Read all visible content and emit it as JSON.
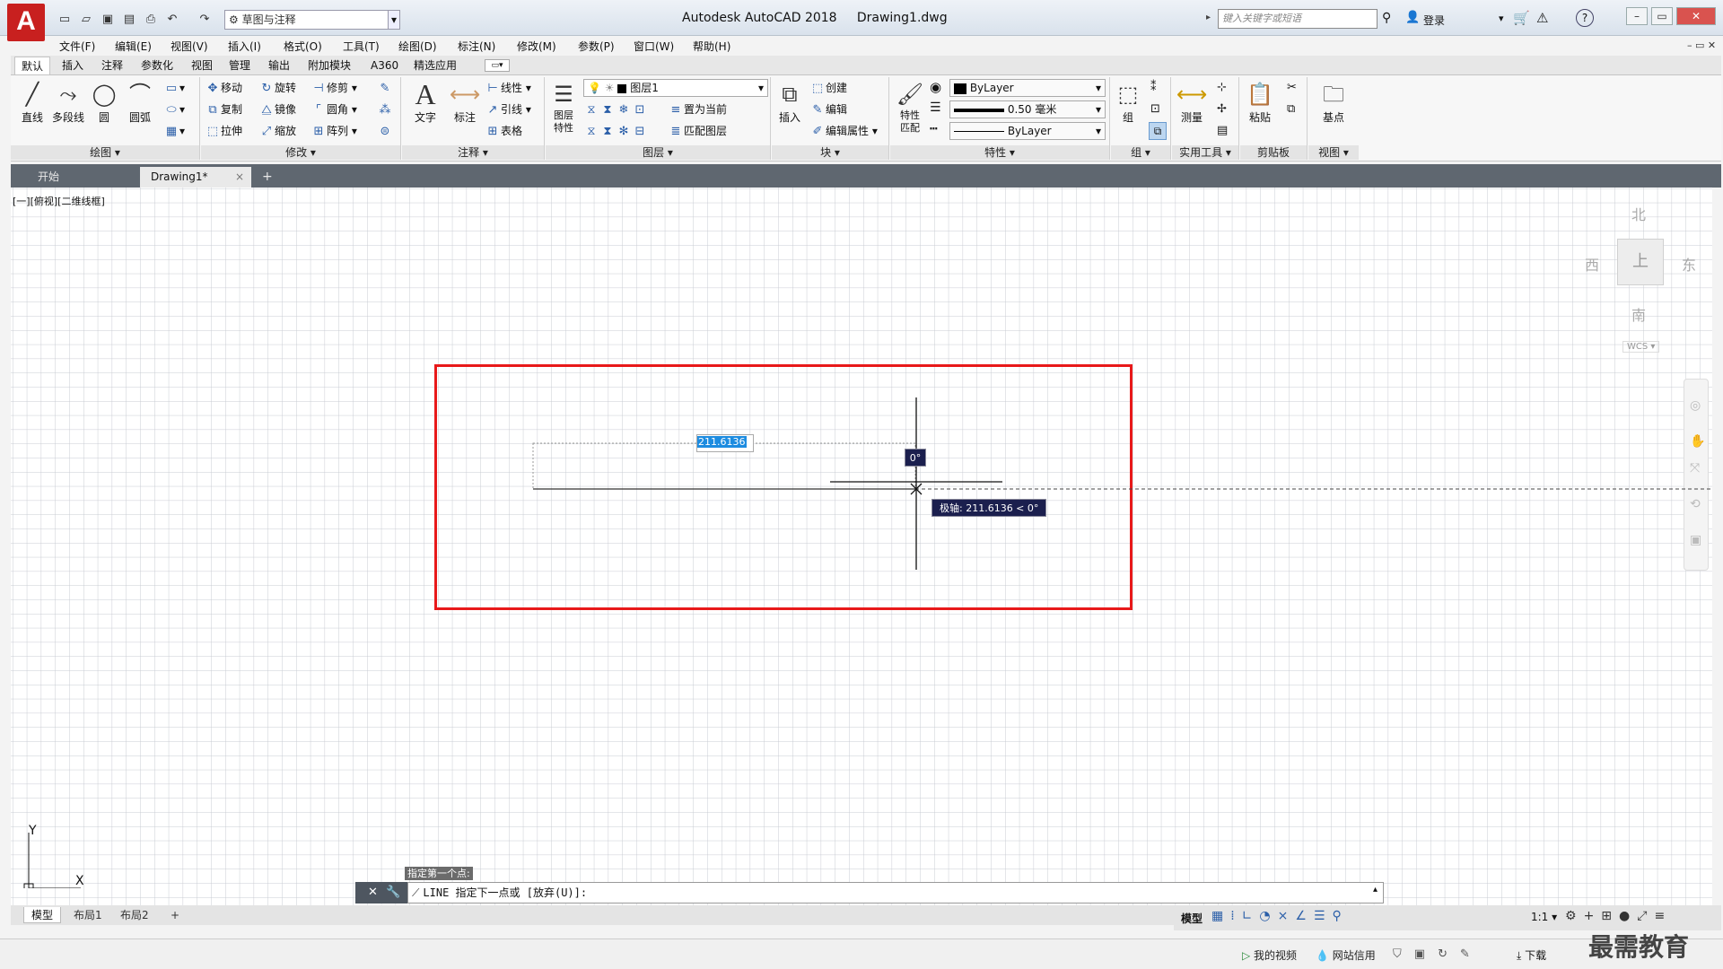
{
  "app": {
    "logo_letter": "A",
    "name": "Autodesk AutoCAD 2018",
    "document": "Drawing1.dwg"
  },
  "qat": {
    "workspace": "草图与注释"
  },
  "search": {
    "placeholder": "键入关键字或短语"
  },
  "user": {
    "login": "登录"
  },
  "menu": [
    "文件(F)",
    "编辑(E)",
    "视图(V)",
    "插入(I)",
    "格式(O)",
    "工具(T)",
    "绘图(D)",
    "标注(N)",
    "修改(M)",
    "参数(P)",
    "窗口(W)",
    "帮助(H)"
  ],
  "ribbon_tabs": [
    "默认",
    "插入",
    "注释",
    "参数化",
    "视图",
    "管理",
    "输出",
    "附加模块",
    "A360",
    "精选应用"
  ],
  "ribbon": {
    "draw": {
      "title": "绘图",
      "line": "直线",
      "polyline": "多段线",
      "circle": "圆",
      "arc": "圆弧"
    },
    "modify": {
      "title": "修改",
      "move": "移动",
      "rotate": "旋转",
      "trim": "修剪",
      "copy": "复制",
      "mirror": "镜像",
      "fillet": "圆角",
      "stretch": "拉伸",
      "scale": "缩放",
      "array": "阵列"
    },
    "annotation": {
      "title": "注释",
      "text": "文字",
      "dimension": "标注",
      "linear": "线性",
      "leader": "引线",
      "table": "表格"
    },
    "layers": {
      "title": "图层",
      "layer_props": "图层\n特性",
      "current_layer": "图层1",
      "set_current": "置为当前",
      "match_layer": "匹配图层"
    },
    "block": {
      "title": "块",
      "insert": "插入",
      "create": "创建",
      "edit": "编辑",
      "edit_attr": "编辑属性"
    },
    "properties": {
      "title": "特性",
      "match": "特性\n匹配",
      "color": "ByLayer",
      "lineweight": "0.50 毫米",
      "linetype": "ByLayer"
    },
    "groups": {
      "title": "组",
      "group": "组"
    },
    "utilities": {
      "title": "实用工具",
      "measure": "测量"
    },
    "clipboard": {
      "title": "剪贴板",
      "paste": "粘贴"
    },
    "view": {
      "title": "视图",
      "base": "基点"
    }
  },
  "doc_tabs": [
    "开始",
    "Drawing1*"
  ],
  "viewport": {
    "label": "[一][俯视][二维线框]"
  },
  "viewcube": {
    "north": "北",
    "south": "南",
    "east": "东",
    "west": "西",
    "top": "上",
    "wcs": "WCS"
  },
  "ucs": {
    "x": "X",
    "y": "Y"
  },
  "dynamic_input": {
    "length": "211.6136",
    "angle": "0°",
    "tooltip": "极轴: 211.6136 < 0°"
  },
  "command": {
    "history": "指定第一个点:",
    "prompt": "LINE 指定下一点或 [放弃(U)]:"
  },
  "sheet_tabs": [
    "模型",
    "布局1",
    "布局2"
  ],
  "status": {
    "model": "模型",
    "scale": "1:1"
  },
  "taskbar": {
    "my_video": "我的视频",
    "net_credit": "网站信用",
    "download": "下载"
  },
  "watermark": "最需教育",
  "colors": {
    "highlight_box": "#e8191a",
    "tooltip_bg": "#1b1f4e",
    "input_highlight": "#1d8ce0"
  }
}
